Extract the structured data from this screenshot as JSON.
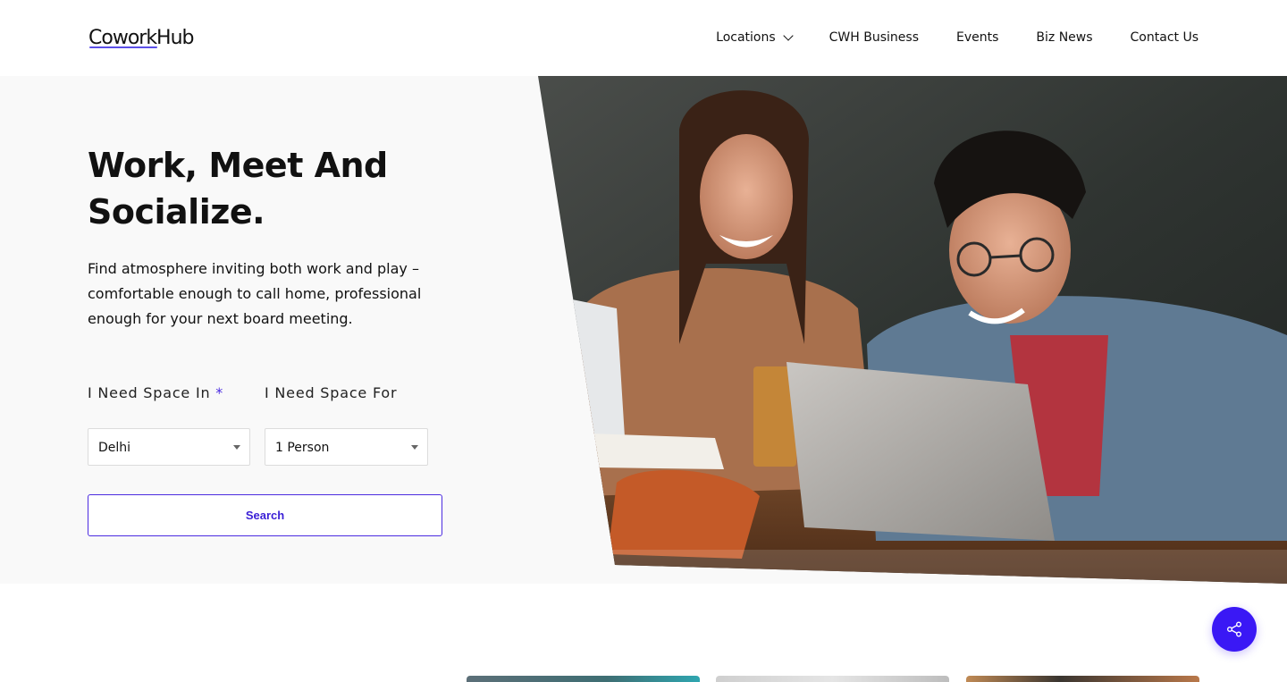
{
  "header": {
    "logo_text": "CoworkHub",
    "nav": [
      {
        "label": "Locations",
        "has_dropdown": true
      },
      {
        "label": "CWH Business"
      },
      {
        "label": "Events"
      },
      {
        "label": "Biz News"
      },
      {
        "label": "Contact Us"
      }
    ]
  },
  "hero": {
    "title_line1": "Work, Meet And",
    "title_line2": "Socialize.",
    "description": "Find atmosphere inviting both work and play – comfortable enough to call home, professional enough for your next board meeting.",
    "form": {
      "space_in_label": "I Need Space In",
      "required_mark": "*",
      "space_in_value": "Delhi",
      "space_for_label": "I Need Space For",
      "space_for_value": "1 Person",
      "search_label": "Search"
    }
  },
  "share": {
    "icon": "share-icon"
  },
  "colors": {
    "accent": "#3a18f5",
    "text": "#111111",
    "hero_bg": "#f9f9f9"
  }
}
